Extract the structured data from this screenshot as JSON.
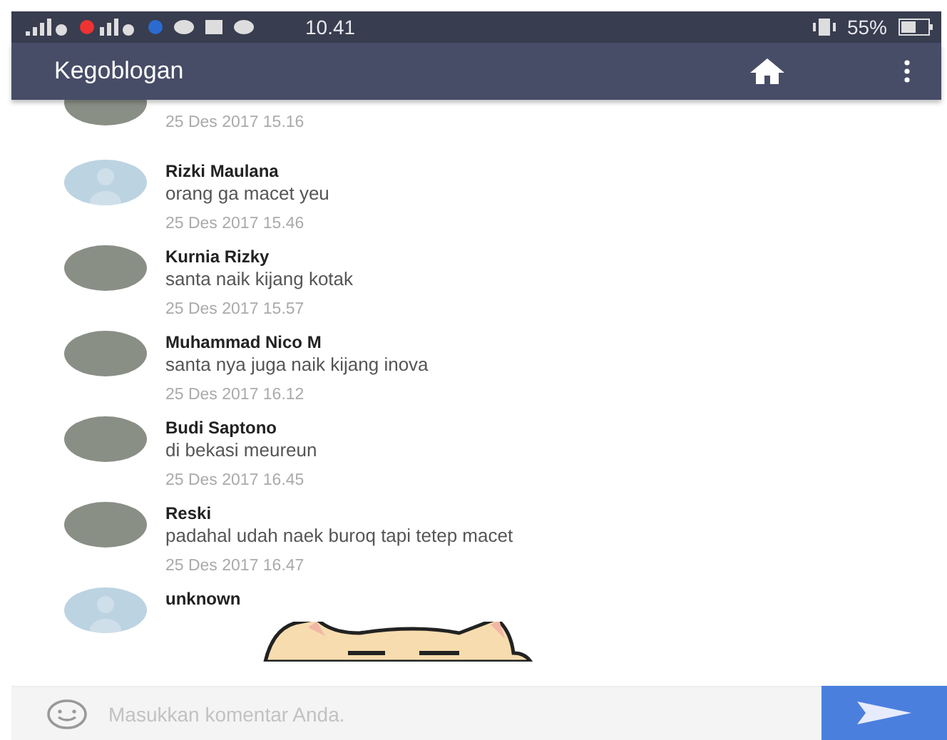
{
  "status_bar": {
    "time": "10.41",
    "battery": "55%"
  },
  "app_bar": {
    "title": "Kegoblogan"
  },
  "comments": [
    {
      "kind": "photo",
      "timestamp": "25 Des 2017 15.16"
    },
    {
      "kind": "default",
      "name": "Rizki Maulana",
      "message": "orang ga macet yeu",
      "timestamp": "25 Des 2017 15.46"
    },
    {
      "kind": "photo",
      "name": "Kurnia Rizky",
      "message": "santa naik kijang kotak",
      "timestamp": "25 Des 2017 15.57"
    },
    {
      "kind": "photo",
      "name": "Muhammad Nico M",
      "message": "santa nya juga naik kijang inova",
      "timestamp": "25 Des 2017 16.12"
    },
    {
      "kind": "photo",
      "name": "Budi Saptono",
      "message": "di bekasi meureun",
      "timestamp": "25 Des 2017 16.45"
    },
    {
      "kind": "photo",
      "name": "Reski",
      "message": "padahal udah naek buroq tapi tetep macet",
      "timestamp": "25 Des 2017 16.47"
    },
    {
      "kind": "default",
      "name": "unknown",
      "sticker": true
    }
  ],
  "comment_input": {
    "placeholder": "Masukkan komentar Anda."
  }
}
